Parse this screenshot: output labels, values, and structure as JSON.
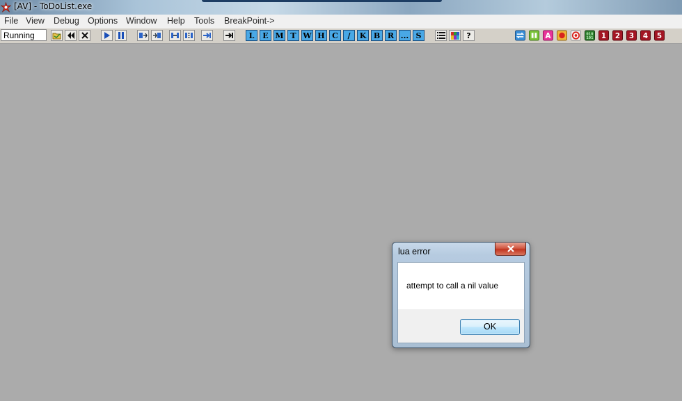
{
  "window": {
    "title": "[AV] - ToDoList.exe",
    "icon": "red-star-icon"
  },
  "menu": {
    "items": [
      "File",
      "View",
      "Debug",
      "Options",
      "Window",
      "Help",
      "Tools",
      "BreakPoint->"
    ]
  },
  "toolbar": {
    "status": "Running",
    "letter_buttons": [
      "L",
      "E",
      "M",
      "T",
      "W",
      "H",
      "C",
      "/",
      "K",
      "B",
      "R",
      "...",
      "S"
    ],
    "number_buttons": [
      "1",
      "2",
      "3",
      "4",
      "5"
    ]
  },
  "dialog": {
    "title": "lua error",
    "message": "attempt to call a nil value",
    "ok_label": "OK"
  },
  "colors": {
    "desktop": "#ababab",
    "toolbar_blue": "#49a8e6",
    "number_red": "#a31523"
  }
}
